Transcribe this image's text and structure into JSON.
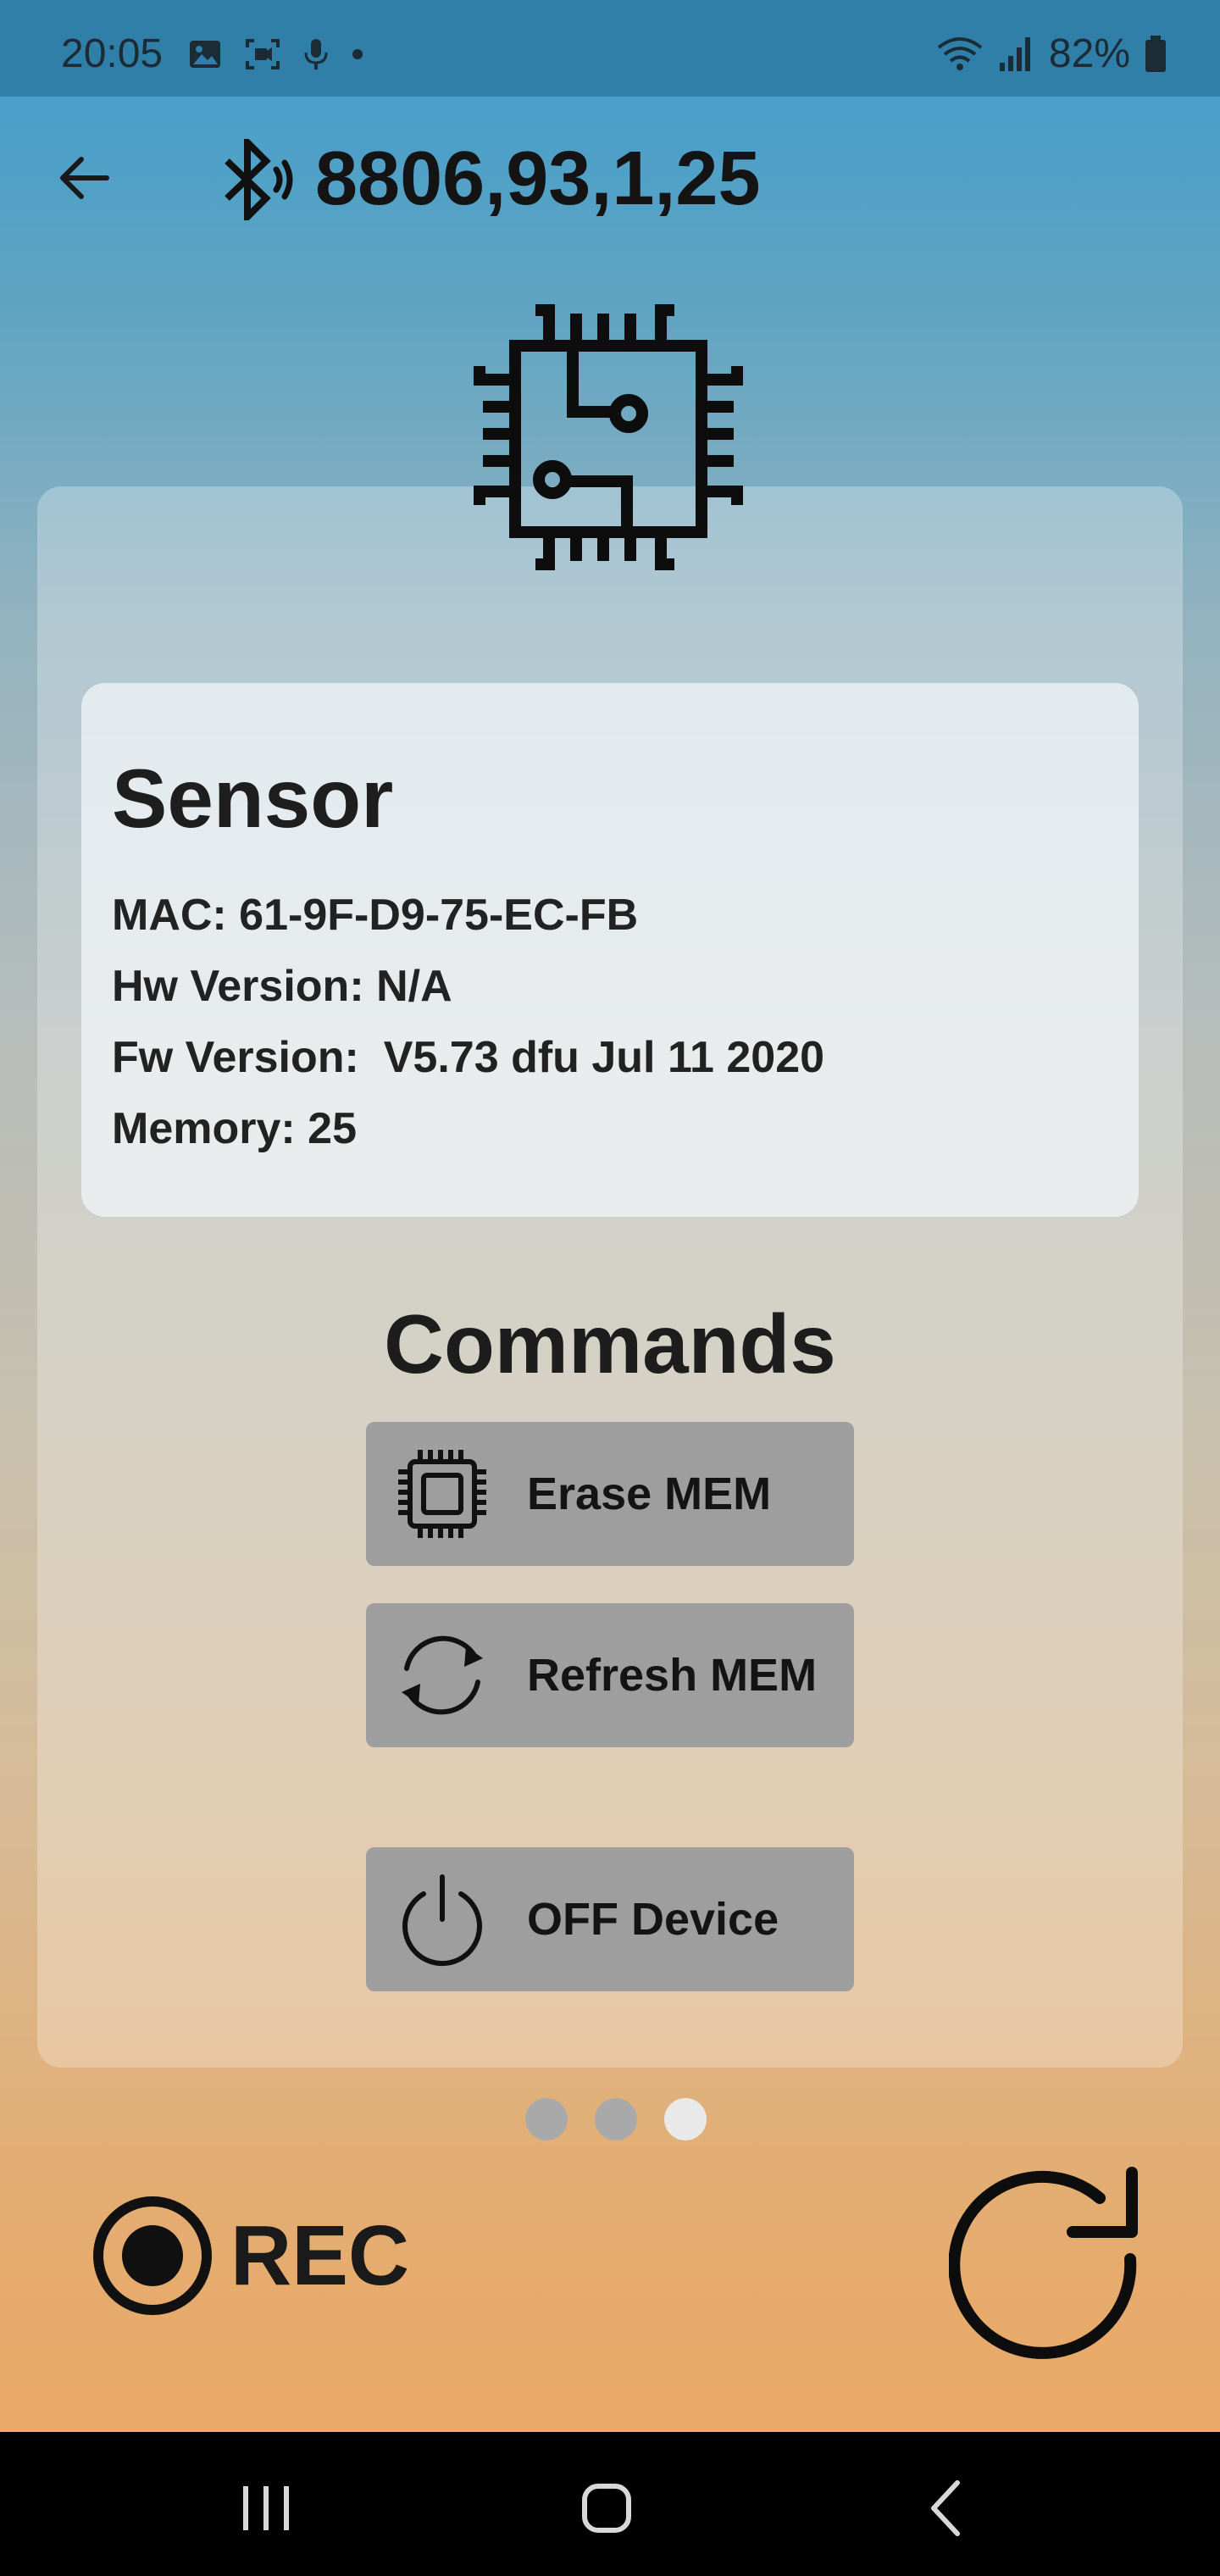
{
  "status_bar": {
    "time": "20:05",
    "battery": "82%",
    "icons": [
      "image-icon",
      "screen-record-icon",
      "mic-icon",
      "dot-icon",
      "wifi-icon",
      "signal-icon",
      "battery-icon"
    ]
  },
  "header": {
    "back_icon": "back-arrow-icon",
    "bluetooth_icon": "bluetooth-connected-icon",
    "title": "8806,93,1,25"
  },
  "hero_icon": "chip-circuit-icon",
  "sensor": {
    "title": "Sensor",
    "mac": "MAC: 61-9F-D9-75-EC-FB",
    "hw": "Hw Version: N/A",
    "fw": "Fw Version:  V5.73 dfu Jul 11 2020",
    "memory": "Memory: 25"
  },
  "commands": {
    "title": "Commands",
    "buttons": [
      {
        "label": "Erase MEM",
        "icon": "memory-chip-icon"
      },
      {
        "label": "Refresh MEM",
        "icon": "sync-icon"
      },
      {
        "label": "OFF Device",
        "icon": "power-icon"
      }
    ]
  },
  "pager": {
    "count": 3,
    "active_index": 2
  },
  "footer": {
    "rec_label": "REC",
    "rec_icon": "record-icon",
    "refresh_icon": "refresh-icon"
  },
  "nav_bar": {
    "icons": [
      "recents-icon",
      "home-icon",
      "back-icon"
    ]
  },
  "colors": {
    "status_bar": "#2f7fa8",
    "button_bg": "#9e9e9e",
    "dot_inactive": "#a9a9a9",
    "dot_active": "#e9e9e9",
    "gradient_top": "#3f9ccd",
    "gradient_bottom": "#eea65e"
  }
}
